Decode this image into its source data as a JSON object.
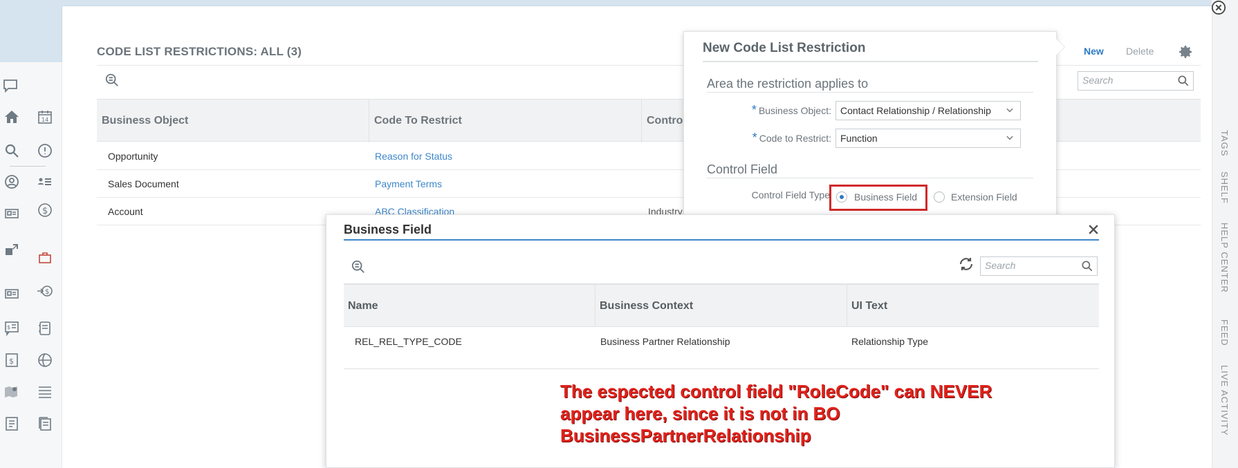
{
  "list": {
    "title": "CODE LIST RESTRICTIONS: ALL (3)",
    "toolbar": {
      "new_label": "New",
      "delete_label": "Delete",
      "search_placeholder": "Search"
    },
    "columns": [
      "Business Object",
      "Code To Restrict",
      "Contro"
    ],
    "rows": [
      {
        "business_object": "Opportunity",
        "code": "Reason for Status",
        "control": ""
      },
      {
        "business_object": "Sales Document",
        "code": "Payment Terms",
        "control": ""
      },
      {
        "business_object": "Account",
        "code": "ABC Classification",
        "control": "Industry"
      }
    ]
  },
  "new_restriction": {
    "title": "New Code List Restriction",
    "area_heading": "Area the restriction applies to",
    "business_object_label": "Business Object:",
    "business_object_value": "Contact Relationship / Relationship",
    "code_label": "Code to Restrict:",
    "code_value": "Function",
    "control_heading": "Control Field",
    "control_type_label": "Control Field Type",
    "option_business": "Business Field",
    "option_extension": "Extension Field",
    "selected_option": "Business Field"
  },
  "business_field_dialog": {
    "title": "Business Field",
    "search_placeholder": "Search",
    "columns": [
      "Name",
      "Business Context",
      "UI Text"
    ],
    "rows": [
      {
        "name": "REL_REL_TYPE_CODE",
        "context": "Business Partner Relationship",
        "ui_text": "Relationship Type"
      }
    ]
  },
  "annotation": {
    "line1": "The espected control field \"RoleCode\" can NEVER",
    "line2": "appear here, since it is not in BO",
    "line3": "BusinessPartnerRelationship",
    "color": "#e3221b"
  },
  "right_strip_labels": [
    "TAGS",
    "SHELF",
    "HELP CENTER",
    "FEED",
    "LIVE ACTIVITY"
  ],
  "colors": {
    "accent": "#2d7bc3",
    "link": "#3d87c9",
    "highlight": "#d12a2a"
  },
  "nav_icons": [
    "feed-icon",
    "home-icon",
    "calendar-icon",
    "search-icon",
    "alert-icon",
    "account-icon",
    "contacts-icon",
    "id-card-icon",
    "currency-icon",
    "transfer-icon",
    "briefcase-icon",
    "payment-icon",
    "notes-icon",
    "list-icon",
    "invoice-icon",
    "globe-dollar-icon",
    "map-icon",
    "list-details-icon",
    "document-icon",
    "documents-icon"
  ]
}
